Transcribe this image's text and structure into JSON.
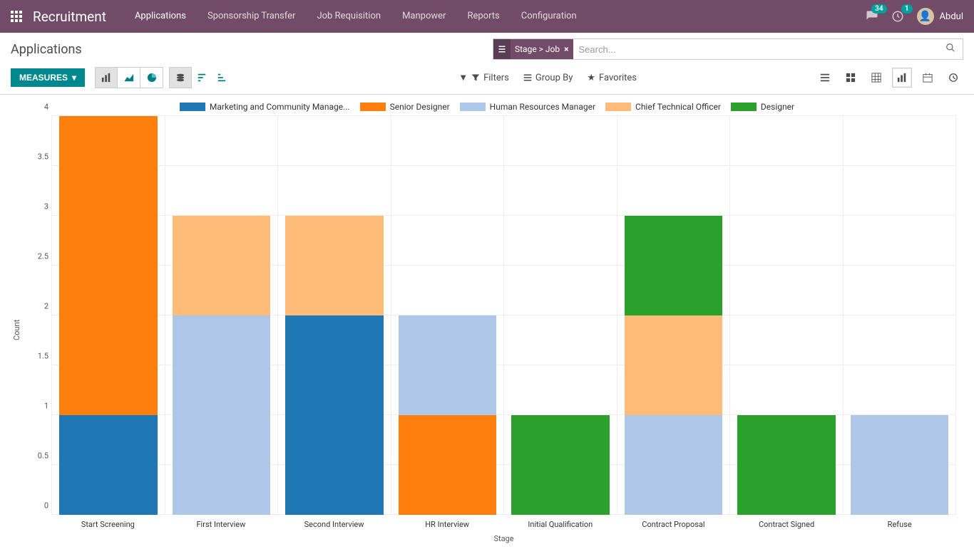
{
  "nav": {
    "brand": "Recruitment",
    "items": [
      "Applications",
      "Sponsorship Transfer",
      "Job Requisition",
      "Manpower",
      "Reports",
      "Configuration"
    ],
    "active": 0,
    "user_name": "Abdul",
    "msg_badge": "34",
    "activity_badge": "1"
  },
  "cp": {
    "breadcrumb": "Applications",
    "search_placeholder": "Search...",
    "facet_label": "Stage > Job",
    "measures_btn": "MEASURES",
    "filters": "Filters",
    "group_by": "Group By",
    "favorites": "Favorites"
  },
  "chart_data": {
    "type": "bar",
    "stacking": "stacked",
    "title": "",
    "xlabel": "Stage",
    "ylabel": "Count",
    "ylim": [
      0,
      4
    ],
    "ystep": 0.5,
    "categories": [
      "Start Screening",
      "First Interview",
      "Second Interview",
      "HR Interview",
      "Initial Qualification",
      "Contract Proposal",
      "Contract Signed",
      "Refuse"
    ],
    "series": [
      {
        "name": "Marketing and Community Manage...",
        "color": "#1f77b4",
        "values": [
          1,
          0,
          2,
          0,
          0,
          0,
          0,
          0
        ]
      },
      {
        "name": "Senior Designer",
        "color": "#ff7f0e",
        "values": [
          3,
          0,
          0,
          1,
          0,
          0,
          0,
          0
        ]
      },
      {
        "name": "Human Resources Manager",
        "color": "#aec7e8",
        "values": [
          0,
          2,
          0,
          1,
          0,
          1,
          0,
          1
        ]
      },
      {
        "name": "Chief Technical Officer",
        "color": "#ffbb78",
        "values": [
          0,
          1,
          1,
          0,
          0,
          1,
          0,
          0
        ]
      },
      {
        "name": "Designer",
        "color": "#2ca02c",
        "values": [
          0,
          0,
          0,
          0,
          1,
          1,
          1,
          0
        ]
      }
    ]
  }
}
